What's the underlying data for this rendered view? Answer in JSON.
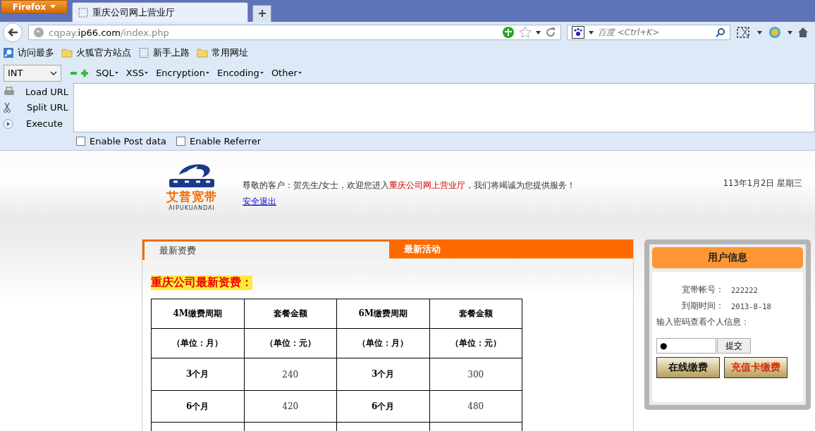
{
  "browser": {
    "menu_button": "Firefox",
    "tabs": [
      {
        "title": "重庆公司网上营业厅",
        "selected": true
      }
    ],
    "address": {
      "host_prefix": "cqpay.",
      "host": "ip66.com",
      "path": "/index.php"
    },
    "search": {
      "placeholder": "百度 <Ctrl+K>"
    },
    "bookmarks": [
      {
        "label": "访问最多",
        "kind": "smart"
      },
      {
        "label": "火狐官方站点",
        "kind": "folder"
      },
      {
        "label": "新手上路",
        "kind": "page"
      },
      {
        "label": "常用网址",
        "kind": "folder"
      }
    ]
  },
  "hackbar": {
    "select": "INT",
    "menus": [
      "SQL",
      "XSS",
      "Encryption",
      "Encoding",
      "Other"
    ],
    "actions": [
      {
        "label": "Load URL",
        "kind": "load"
      },
      {
        "label": "Split URL",
        "kind": "split"
      },
      {
        "label": "Execute",
        "kind": "execute"
      }
    ],
    "options": [
      {
        "label": "Enable Post data",
        "checked": false
      },
      {
        "label": "Enable Referrer",
        "checked": false
      }
    ]
  },
  "header": {
    "logo_text": "艾普宽带",
    "logo_sub": "AIPUKUANDAI",
    "greeting_before": "尊敬的客户：贺先生/女士，欢迎您进入",
    "greeting_highlight": "重庆公司网上营业厅",
    "greeting_after": "，我们将竭诚为您提供服务！",
    "logout": "安全退出",
    "date": "113年1月2日  星期三"
  },
  "content_tabs": [
    {
      "label": "最新资费",
      "selected": true
    },
    {
      "label": "最新活动",
      "selected": false
    }
  ],
  "fees": {
    "title": "重庆公司最新资费：",
    "header_rows": [
      [
        "4M缴费周期",
        "套餐金额",
        "6M缴费周期",
        "套餐金额"
      ],
      [
        "（单位：月）",
        "（单位：元）",
        "（单位：月）",
        "（单位：元）"
      ]
    ],
    "rows": [
      [
        "3个月",
        "240",
        "3个月",
        "300"
      ],
      [
        "6个月",
        "420",
        "6个月",
        "480"
      ]
    ]
  },
  "user_info": {
    "title": "用户信息",
    "fields": [
      {
        "label": "宽带帐号：",
        "value": "222222"
      },
      {
        "label": "到期时间：",
        "value": "2013-8-18"
      }
    ],
    "prompt": "输入密码查看个人信息：",
    "password": "●",
    "submit": "提交",
    "buttons": [
      {
        "label": "在线缴费",
        "kind": "dark"
      },
      {
        "label": "充值卡缴费",
        "kind": "red"
      }
    ]
  }
}
